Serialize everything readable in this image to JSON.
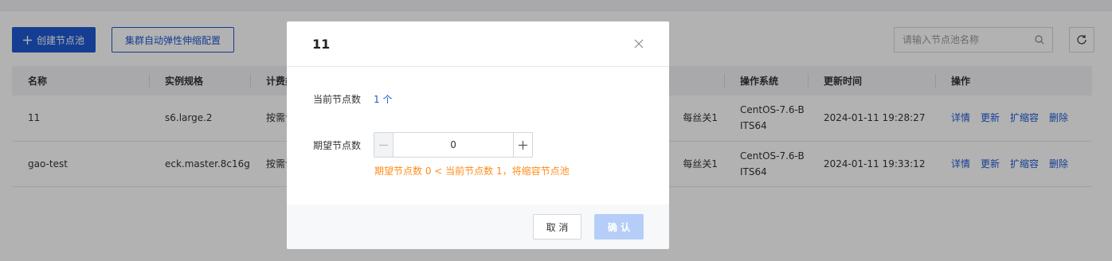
{
  "toolbar": {
    "create_label": "创建节点池",
    "autoscale_label": "集群自动弹性伸缩配置"
  },
  "search": {
    "placeholder": "请输入节点池名称"
  },
  "table": {
    "headers": [
      "名称",
      "实例规格",
      "计费类",
      "",
      "操作系统",
      "更新时间",
      "操作"
    ],
    "rows": [
      {
        "name": "11",
        "spec": "s6.large.2",
        "billing": "按需计",
        "net": "每丝关1",
        "os": "CentOS-7.6-BITS64",
        "updated": "2024-01-11 19:28:27",
        "ops": [
          "详情",
          "更新",
          "扩缩容",
          "删除"
        ]
      },
      {
        "name": "gao-test",
        "spec": "eck.master.8c16g",
        "billing": "按需计",
        "net": "每丝关1",
        "os": "CentOS-7.6-BITS64",
        "updated": "2024-01-11 19:33:12",
        "ops": [
          "详情",
          "更新",
          "扩缩容",
          "删除"
        ]
      }
    ]
  },
  "dialog": {
    "title": "11",
    "current_label": "当前节点数",
    "current_value": "1 个",
    "desired_label": "期望节点数",
    "desired_value": "0",
    "warning": "期望节点数 0 < 当前节点数 1，将缩容节点池",
    "cancel_label": "取 消",
    "ok_label": "确 认"
  },
  "colors": {
    "primary": "#1f5ad3",
    "warning": "#ff8c1a",
    "disabled_primary": "#b6cef7"
  }
}
